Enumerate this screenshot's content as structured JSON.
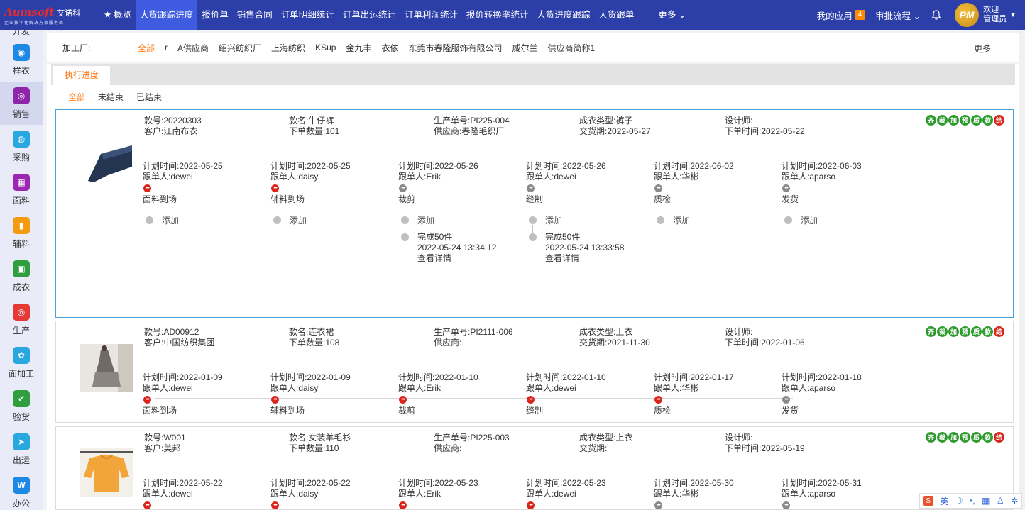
{
  "app": {
    "logo_brand": "Aumsoft",
    "logo_cn": "艾诺科",
    "logo_sub": "企业数字化解决方案服务商"
  },
  "topnav": {
    "items": [
      {
        "label": "概览"
      },
      {
        "label": "大货跟踪进度"
      },
      {
        "label": "报价单"
      },
      {
        "label": "销售合同"
      },
      {
        "label": "订单明细统计"
      },
      {
        "label": "订单出运统计"
      },
      {
        "label": "订单利润统计"
      },
      {
        "label": "报价转换率统计"
      },
      {
        "label": "大货进度跟踪"
      },
      {
        "label": "大货跟单"
      }
    ],
    "more": "更多 ⌄",
    "my_apps": "我的应用",
    "my_apps_count": "4",
    "approval": "审批流程 ⌄",
    "avatar_text": "PM",
    "welcome_1": "欢迎",
    "welcome_2": "管理员"
  },
  "sidebar": {
    "cut_label": "开发",
    "items": [
      {
        "label": "样衣",
        "icon": "sample-icon",
        "color": "#1e88e5"
      },
      {
        "label": "销售",
        "icon": "sales-icon",
        "color": "#8e24aa"
      },
      {
        "label": "采购",
        "icon": "purchase-icon",
        "color": "#29a8e0"
      },
      {
        "label": "面料",
        "icon": "fabric-icon",
        "color": "#9c27b0"
      },
      {
        "label": "辅料",
        "icon": "accessory-icon",
        "color": "#f39c12"
      },
      {
        "label": "成衣",
        "icon": "garment-icon",
        "color": "#2e9e3f"
      },
      {
        "label": "生产",
        "icon": "production-icon",
        "color": "#e53935"
      },
      {
        "label": "面加工",
        "icon": "processing-icon",
        "color": "#29a8e0"
      },
      {
        "label": "验货",
        "icon": "inspection-icon",
        "color": "#2e9e3f"
      },
      {
        "label": "出运",
        "icon": "shipping-icon",
        "color": "#29a8e0"
      },
      {
        "label": "办公",
        "icon": "office-icon",
        "color": "#1e88e5"
      }
    ]
  },
  "filter": {
    "label": "加工厂:",
    "options": [
      "全部",
      "r",
      "A供应商",
      "绍兴纺织厂",
      "上海纺织",
      "KSup",
      "金九丰",
      "衣依",
      "东莞市春隆服饰有限公司",
      "威尔兰",
      "供应商简称1"
    ],
    "more": "更多"
  },
  "tabs": {
    "main": "执行进度",
    "sub": [
      "全部",
      "未结束",
      "已结束"
    ]
  },
  "tags": [
    "齐",
    "裁",
    "加",
    "预",
    "质",
    "款",
    "结"
  ],
  "orders": [
    {
      "style_no": "款号:20220303",
      "customer": "客户:江南布衣",
      "style_name": "款名:牛仔裤",
      "qty": "下单数量:101",
      "prod_no": "生产单号:PI225-004",
      "supplier": "供应商:春隆毛织厂",
      "type": "成衣类型:裤子",
      "delivery": "交货期:2022-05-27",
      "designer": "设计师:",
      "order_time": "下单时间:2022-05-22",
      "steps": [
        {
          "plan": "计划时间:2022-05-25",
          "owner": "跟单人:dewei",
          "name": "面料到场",
          "status": "red",
          "add": "添加"
        },
        {
          "plan": "计划时间:2022-05-25",
          "owner": "跟单人:daisy",
          "name": "辅料到场",
          "status": "red",
          "add": "添加"
        },
        {
          "plan": "计划时间:2022-05-26",
          "owner": "跟单人:Erik",
          "name": "裁剪",
          "status": "grey",
          "add": "添加",
          "log": {
            "done": "完成50件",
            "time": "2022-05-24 13:34:12",
            "detail": "查看详情"
          }
        },
        {
          "plan": "计划时间:2022-05-26",
          "owner": "跟单人:dewei",
          "name": "缝制",
          "status": "grey",
          "add": "添加",
          "log": {
            "done": "完成50件",
            "time": "2022-05-24 13:33:58",
            "detail": "查看详情"
          }
        },
        {
          "plan": "计划时间:2022-06-02",
          "owner": "跟单人:华彬",
          "name": "质检",
          "status": "grey",
          "add": "添加"
        },
        {
          "plan": "计划时间:2022-06-03",
          "owner": "跟单人:aparso",
          "name": "发货",
          "status": "grey",
          "add": "添加"
        }
      ]
    },
    {
      "style_no": "款号:AD00912",
      "customer": "客户:中国纺织集团",
      "style_name": "款名:连衣裙",
      "qty": "下单数量:108",
      "prod_no": "生产单号:PI2111-006",
      "supplier": "供应商:",
      "type": "成衣类型:上衣",
      "delivery": "交货期:2021-11-30",
      "designer": "设计师:",
      "order_time": "下单时间:2022-01-06",
      "steps": [
        {
          "plan": "计划时间:2022-01-09",
          "owner": "跟单人:dewei",
          "name": "面料到场",
          "status": "red"
        },
        {
          "plan": "计划时间:2022-01-09",
          "owner": "跟单人:daisy",
          "name": "辅料到场",
          "status": "red"
        },
        {
          "plan": "计划时间:2022-01-10",
          "owner": "跟单人:Erik",
          "name": "裁剪",
          "status": "red"
        },
        {
          "plan": "计划时间:2022-01-10",
          "owner": "跟单人:dewei",
          "name": "缝制",
          "status": "red"
        },
        {
          "plan": "计划时间:2022-01-17",
          "owner": "跟单人:华彬",
          "name": "质检",
          "status": "red"
        },
        {
          "plan": "计划时间:2022-01-18",
          "owner": "跟单人:aparso",
          "name": "发货",
          "status": "grey"
        }
      ]
    },
    {
      "style_no": "款号:W001",
      "customer": "客户:美邦",
      "style_name": "款名:女装羊毛衫",
      "qty": "下单数量:110",
      "prod_no": "生产单号:PI225-003",
      "supplier": "供应商:",
      "type": "成衣类型:上衣",
      "delivery": "交货期:",
      "designer": "设计师:",
      "order_time": "下单时间:2022-05-19",
      "steps": [
        {
          "plan": "计划时间:2022-05-22",
          "owner": "跟单人:dewei",
          "status": "red"
        },
        {
          "plan": "计划时间:2022-05-22",
          "owner": "跟单人:daisy",
          "status": "red"
        },
        {
          "plan": "计划时间:2022-05-23",
          "owner": "跟单人:Erik",
          "status": "red"
        },
        {
          "plan": "计划时间:2022-05-23",
          "owner": "跟单人:dewei",
          "status": "red"
        },
        {
          "plan": "计划时间:2022-05-30",
          "owner": "跟单人:华彬",
          "status": "grey"
        },
        {
          "plan": "计划时间:2022-05-31",
          "owner": "跟单人:aparso",
          "status": "grey"
        }
      ]
    }
  ],
  "ime": {
    "label": "英"
  }
}
